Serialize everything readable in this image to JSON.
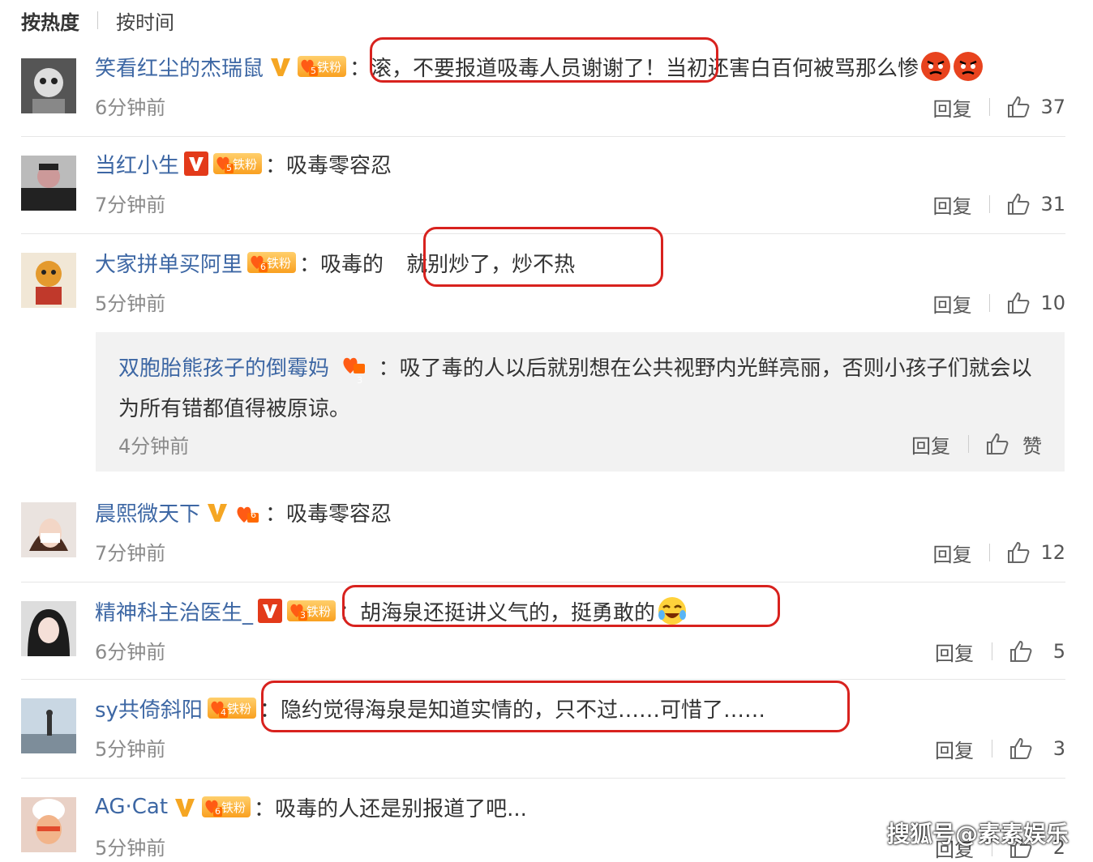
{
  "sort": {
    "active": "按热度",
    "other": "按时间"
  },
  "comments": [
    {
      "user": "笑看红尘的杰瑞鼠",
      "fan_level": "5",
      "fan_label": "铁粉",
      "text": "滚，不要报道吸毒人员谢谢了！当初还害白百何被骂那么惨",
      "time": "6分钟前",
      "reply": "回复",
      "likes": "37"
    },
    {
      "user": "当红小生",
      "fan_level": "5",
      "fan_label": "铁粉",
      "text": "吸毒零容忍",
      "time": "7分钟前",
      "reply": "回复",
      "likes": "31"
    },
    {
      "user": "大家拼单买阿里",
      "fan_level": "6",
      "fan_label": "铁粉",
      "text_a": "吸毒的",
      "text_b": "就别炒了，炒不热",
      "time": "5分钟前",
      "reply": "回复",
      "likes": "10"
    },
    {
      "user": "晨熙微天下",
      "fan_level": "6",
      "text": "吸毒零容忍",
      "time": "7分钟前",
      "reply": "回复",
      "likes": "12"
    },
    {
      "user": "精神科主治医生_",
      "fan_level": "3",
      "fan_label": "铁粉",
      "text": "胡海泉还挺讲义气的，挺勇敢的",
      "time": "6分钟前",
      "reply": "回复",
      "likes": "5"
    },
    {
      "user": "sy共倚斜阳",
      "fan_level": "4",
      "fan_label": "铁粉",
      "text": "隐约觉得海泉是知道实情的，只不过……可惜了……",
      "time": "5分钟前",
      "reply": "回复",
      "likes": "3"
    },
    {
      "user": "AG·Cat",
      "fan_level": "6",
      "fan_label": "铁粉",
      "text": "吸毒的人还是别报道了吧...",
      "time": "5分钟前",
      "reply": "回复",
      "likes": "2"
    }
  ],
  "sub_reply": {
    "user": "双胞胎熊孩子的倒霉妈",
    "fan_level": "3",
    "text": "吸了毒的人以后就别想在公共视野内光鲜亮丽，否则小孩子们就会以为所有错都值得被原谅。",
    "time": "4分钟前",
    "reply": "回复",
    "likes": "赞"
  },
  "watermark": "搜狐号@素素娱乐",
  "colors": {
    "username": "#3d67a4",
    "highlight": "#d8221e",
    "verified": "#f5a623"
  }
}
